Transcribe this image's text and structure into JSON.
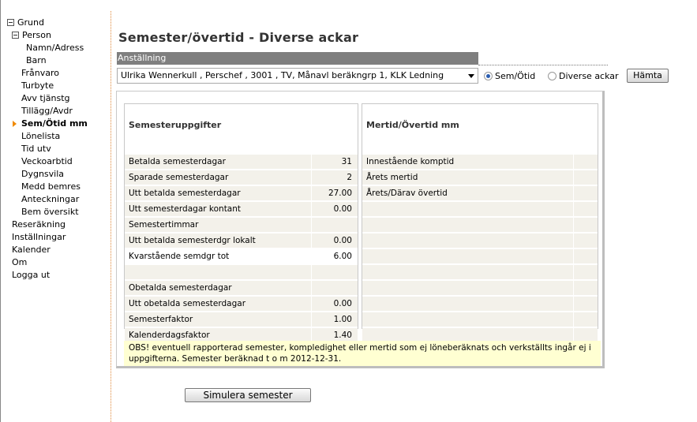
{
  "nav": {
    "items": [
      {
        "label": "Grund",
        "level": 0,
        "tree": true,
        "active": false
      },
      {
        "label": "Person",
        "level": 1,
        "tree": true,
        "active": false
      },
      {
        "label": "Namn/Adress",
        "level": 3,
        "tree": false,
        "active": false
      },
      {
        "label": "Barn",
        "level": 3,
        "tree": false,
        "active": false
      },
      {
        "label": "Frånvaro",
        "level": 2,
        "tree": false,
        "active": false
      },
      {
        "label": "Turbyte",
        "level": 2,
        "tree": false,
        "active": false
      },
      {
        "label": "Avv tjänstg",
        "level": 2,
        "tree": false,
        "active": false
      },
      {
        "label": "Tillägg/Avdr",
        "level": 2,
        "tree": false,
        "active": false
      },
      {
        "label": "Sem/Ötid mm",
        "level": 2,
        "tree": false,
        "active": true
      },
      {
        "label": "Lönelista",
        "level": 2,
        "tree": false,
        "active": false
      },
      {
        "label": "Tid utv",
        "level": 2,
        "tree": false,
        "active": false
      },
      {
        "label": "Veckoarbtid",
        "level": 2,
        "tree": false,
        "active": false
      },
      {
        "label": "Dygnsvila",
        "level": 2,
        "tree": false,
        "active": false
      },
      {
        "label": "Medd bemres",
        "level": 2,
        "tree": false,
        "active": false
      },
      {
        "label": "Anteckningar",
        "level": 2,
        "tree": false,
        "active": false
      },
      {
        "label": "Bem översikt",
        "level": 2,
        "tree": false,
        "active": false
      },
      {
        "label": "Reseräkning",
        "level": 1,
        "tree": false,
        "active": false
      },
      {
        "label": "Inställningar",
        "level": 1,
        "tree": false,
        "active": false
      },
      {
        "label": "Kalender",
        "level": 1,
        "tree": false,
        "active": false
      },
      {
        "label": "Om",
        "level": 1,
        "tree": false,
        "active": false
      },
      {
        "label": "Logga ut",
        "level": 1,
        "tree": false,
        "active": false
      }
    ]
  },
  "page": {
    "title": "Semester/övertid - Diverse ackar"
  },
  "employment": {
    "header": "Anställning",
    "selected": "Ulrika Wennerkull , Perschef , 3001 , TV, Månavl beräkngrp 1, KLK Ledning"
  },
  "mode": {
    "options": [
      {
        "label": "Sem/Ötid",
        "selected": true
      },
      {
        "label": "Diverse ackar",
        "selected": false
      }
    ],
    "fetch_label": "Hämta"
  },
  "semester": {
    "title": "Semesteruppgifter",
    "rows": [
      {
        "label": "",
        "value": "",
        "shade": false
      },
      {
        "label": "Betalda semesterdagar",
        "value": "31",
        "shade": true
      },
      {
        "label": "Sparade semesterdagar",
        "value": "2",
        "shade": true
      },
      {
        "label": "Utt betalda semesterdagar",
        "value": "27.00",
        "shade": true
      },
      {
        "label": "Utt semesterdagar kontant",
        "value": "0.00",
        "shade": true
      },
      {
        "label": "Semestertimmar",
        "value": "",
        "shade": true
      },
      {
        "label": "Utt betalda semesterdgr lokalt",
        "value": "0.00",
        "shade": true
      },
      {
        "label": "Kvarstående semdgr tot",
        "value": "6.00",
        "shade": false
      },
      {
        "label": "",
        "value": "",
        "shade": true
      },
      {
        "label": "Obetalda semesterdagar",
        "value": "",
        "shade": true
      },
      {
        "label": "Utt obetalda semesterdagar",
        "value": "0.00",
        "shade": true
      },
      {
        "label": "Semesterfaktor",
        "value": "1.00",
        "shade": true
      },
      {
        "label": "Kalenderdagsfaktor",
        "value": "1.40",
        "shade": true
      }
    ]
  },
  "mertid": {
    "title": "Mertid/Övertid mm",
    "rows": [
      {
        "label": "",
        "value": "",
        "shade": false
      },
      {
        "label": "Innestående komptid",
        "value": "",
        "shade": true
      },
      {
        "label": "Årets mertid",
        "value": "",
        "shade": true
      },
      {
        "label": "Årets/Därav övertid",
        "value": "",
        "shade": true
      },
      {
        "label": "",
        "value": "",
        "shade": true
      },
      {
        "label": "",
        "value": "",
        "shade": true
      },
      {
        "label": "",
        "value": "",
        "shade": true
      },
      {
        "label": "",
        "value": "",
        "shade": true
      },
      {
        "label": "",
        "value": "",
        "shade": true
      },
      {
        "label": "",
        "value": "",
        "shade": true
      },
      {
        "label": "",
        "value": "",
        "shade": true
      },
      {
        "label": "",
        "value": "",
        "shade": true
      },
      {
        "label": "",
        "value": "",
        "shade": true
      }
    ]
  },
  "notice": {
    "text": "OBS! eventuell rapporterad semester, kompledighet eller mertid som ej löneberäknats och verkställts ingår ej i uppgifterna. Semester beräknad t o m 2012-12-31."
  },
  "simulate": {
    "label": "Simulera semester"
  },
  "colors": {
    "nav_marker": "#f08a00",
    "header_bar": "#7f7f7f",
    "row_shade": "#f3f1ea",
    "notice_bg": "#ffffd2",
    "divider": "#e08a3c"
  },
  "icons": {
    "tree_collapse": "minus-box-icon",
    "active_marker": "arrow-right-icon",
    "dropdown": "chevron-down-icon"
  }
}
